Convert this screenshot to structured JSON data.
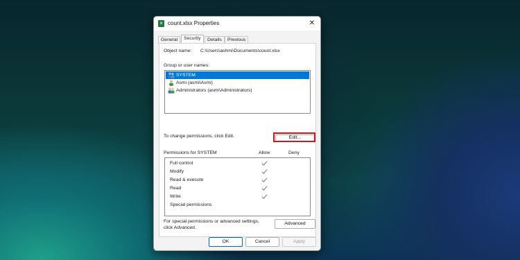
{
  "window": {
    "title": "count.xlsx Properties",
    "close_glyph": "✕"
  },
  "tabs": [
    {
      "label": "General"
    },
    {
      "label": "Security"
    },
    {
      "label": "Details"
    },
    {
      "label": "Previous Versions"
    }
  ],
  "security": {
    "object_name_label": "Object name:",
    "object_name_value": "C:\\Users\\ashmi\\Documents\\count.xlsx",
    "group_label": "Group or user names:",
    "users": [
      {
        "label": "SYSTEM",
        "selected": true
      },
      {
        "label": "Asmi (asmi\\Asmi)",
        "selected": false
      },
      {
        "label": "Administrators (asmi\\Administrators)",
        "selected": false
      }
    ],
    "change_text": "To change permissions, click Edit.",
    "edit_label": "Edit...",
    "permissions_for": "Permissions for SYSTEM",
    "allow_header": "Allow",
    "deny_header": "Deny",
    "permissions": [
      {
        "name": "Full control",
        "allow": true,
        "deny": false
      },
      {
        "name": "Modify",
        "allow": true,
        "deny": false
      },
      {
        "name": "Read & execute",
        "allow": true,
        "deny": false
      },
      {
        "name": "Read",
        "allow": true,
        "deny": false
      },
      {
        "name": "Write",
        "allow": true,
        "deny": false
      },
      {
        "name": "Special permissions",
        "allow": false,
        "deny": false
      }
    ],
    "advanced_text_1": "For special permissions or advanced settings,",
    "advanced_text_2": "click Advanced.",
    "advanced_label": "Advanced"
  },
  "footer": {
    "ok_label": "OK",
    "cancel_label": "Cancel",
    "apply_label": "Apply"
  },
  "colors": {
    "selection": "#0078d7",
    "highlight_border": "#e0101a",
    "excel_green": "#1f7a43"
  }
}
